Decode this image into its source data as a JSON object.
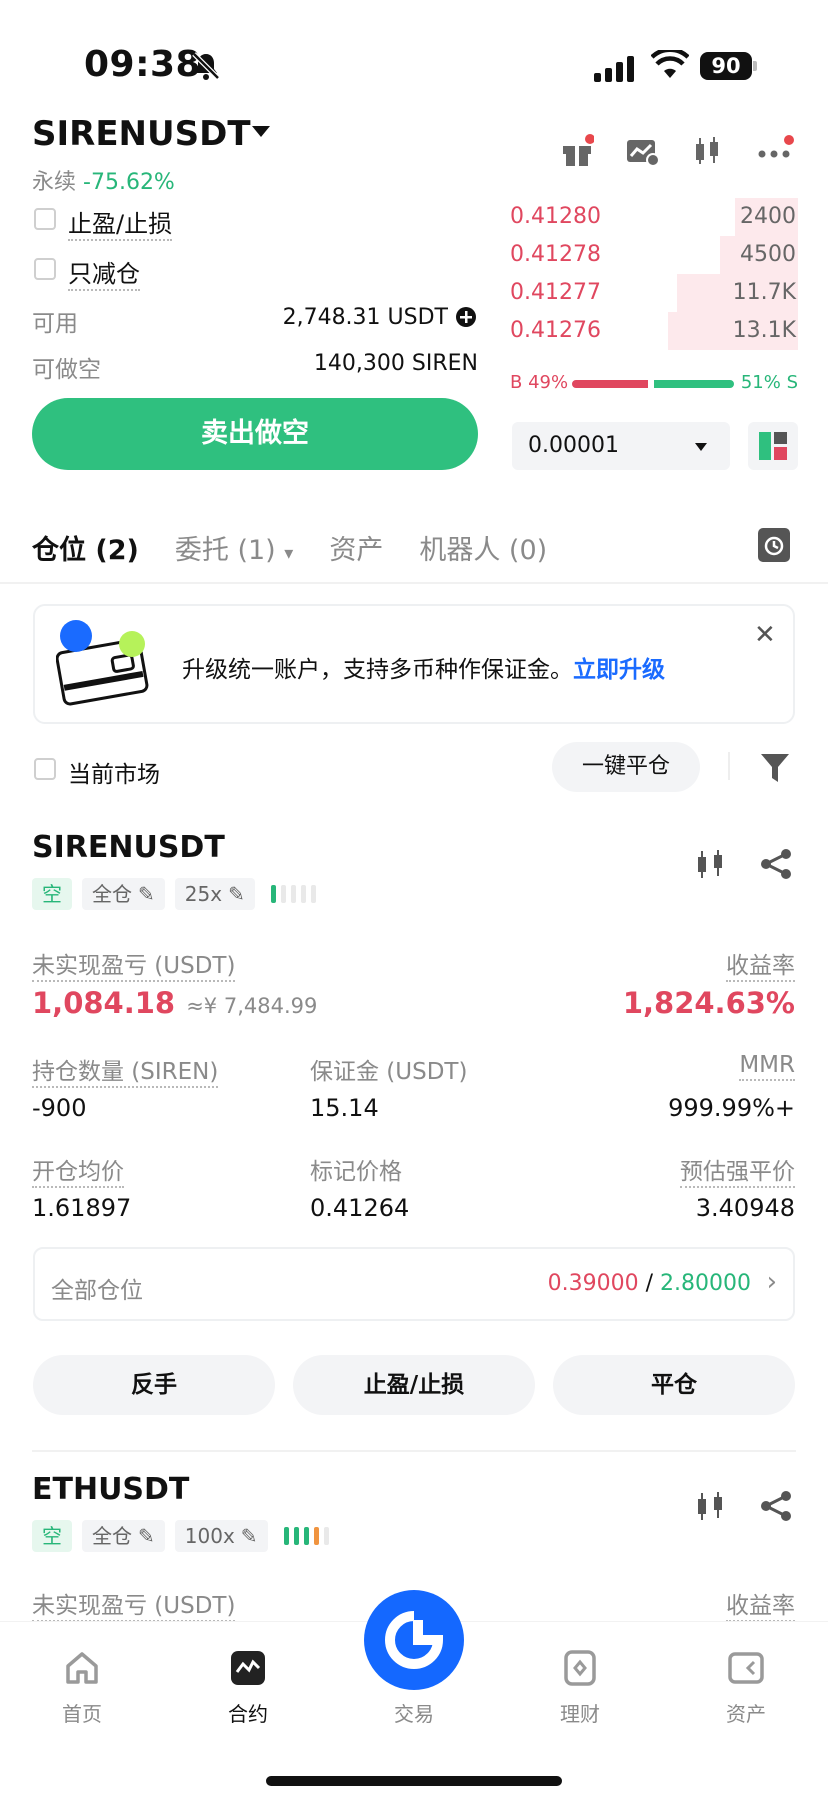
{
  "status_bar": {
    "time": "09:38",
    "battery": "90"
  },
  "header": {
    "pair": "SIRENUSDT",
    "type_label": "永续",
    "change": "-75.62%"
  },
  "trade_panel": {
    "tp_sl_label": "止盈/止损",
    "reduce_only_label": "只减仓",
    "available_label": "可用",
    "available_value": "2,748.31 USDT",
    "shortable_label": "可做空",
    "shortable_value": "140,300 SIREN",
    "sell_button": "卖出做空"
  },
  "order_book": {
    "asks": [
      {
        "price": "0.41280",
        "qty": "2400",
        "depth": 0.22
      },
      {
        "price": "0.41278",
        "qty": "4500",
        "depth": 0.27
      },
      {
        "price": "0.41277",
        "qty": "11.7K",
        "depth": 0.42
      },
      {
        "price": "0.41276",
        "qty": "13.1K",
        "depth": 0.45
      }
    ],
    "buy_ratio": "B 49%",
    "sell_ratio": "51% S",
    "buy_fraction": 0.49,
    "tick_size": "0.00001"
  },
  "tabs": [
    {
      "label": "仓位 (2)"
    },
    {
      "label": "委托 (1)"
    },
    {
      "label": "资产"
    },
    {
      "label": "机器人 (0)"
    }
  ],
  "banner": {
    "text": "升级统一账户，支持多币种作保证金。",
    "link": "立即升级"
  },
  "filter": {
    "current_market_label": "当前市场",
    "close_all_label": "一键平仓"
  },
  "positions": [
    {
      "symbol": "SIRENUSDT",
      "side": "空",
      "margin_mode": "全仓",
      "leverage": "25x",
      "unrealized_label": "未实现盈亏 (USDT)",
      "unrealized_value": "1,084.18",
      "unrealized_cny": "≈¥ 7,484.99",
      "roe_label": "收益率",
      "roe_value": "1,824.63%",
      "size_label": "持仓数量 (SIREN)",
      "size_value": "-900",
      "margin_label": "保证金 (USDT)",
      "margin_value": "15.14",
      "mmr_label": "MMR",
      "mmr_value": "999.99%+",
      "entry_label": "开仓均价",
      "entry_value": "1.61897",
      "mark_label": "标记价格",
      "mark_value": "0.41264",
      "liq_label": "预估强平价",
      "liq_value": "3.40948",
      "all_pos_label": "全部仓位",
      "tp_value": "0.39000",
      "sl_value": "2.80000",
      "btn_reverse": "反手",
      "btn_tpsl": "止盈/止损",
      "btn_close": "平仓"
    },
    {
      "symbol": "ETHUSDT",
      "side": "空",
      "margin_mode": "全仓",
      "leverage": "100x",
      "unrealized_label": "未实现盈亏 (USDT)",
      "roe_label": "收益率"
    }
  ],
  "bottom_nav": [
    {
      "label": "首页"
    },
    {
      "label": "合约"
    },
    {
      "label": "交易"
    },
    {
      "label": "理财"
    },
    {
      "label": "资产"
    }
  ],
  "colors": {
    "green": "#2fc07f",
    "red": "#e0475f",
    "blue": "#1468ff",
    "orange": "#f0943f"
  }
}
